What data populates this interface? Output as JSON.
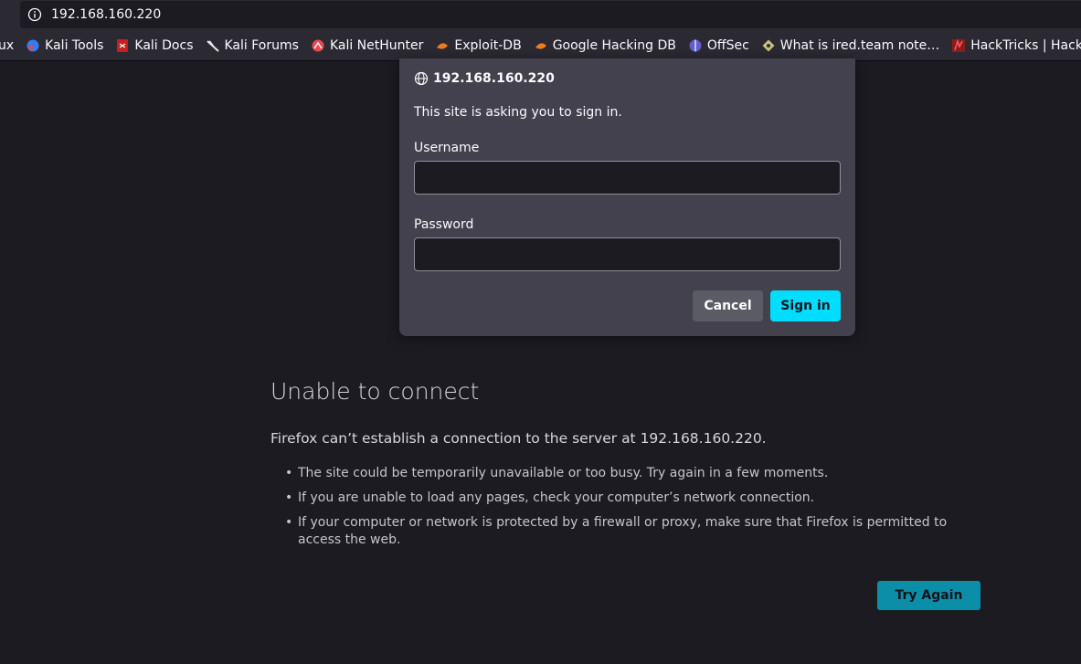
{
  "urlbar": {
    "url": "192.168.160.220",
    "icon": "info-icon"
  },
  "bookmarks": [
    {
      "label": "ux",
      "icon": ""
    },
    {
      "label": "Kali Tools",
      "icon": "kali-tools-icon"
    },
    {
      "label": "Kali Docs",
      "icon": "kali-docs-icon"
    },
    {
      "label": "Kali Forums",
      "icon": "kali-forums-icon"
    },
    {
      "label": "Kali NetHunter",
      "icon": "kali-nethunter-icon"
    },
    {
      "label": "Exploit-DB",
      "icon": "exploit-db-icon"
    },
    {
      "label": "Google Hacking DB",
      "icon": "google-hacking-db-icon"
    },
    {
      "label": "OffSec",
      "icon": "offsec-icon"
    },
    {
      "label": "What is ired.team note…",
      "icon": "ired-team-icon"
    },
    {
      "label": "HackTricks | HackTricks",
      "icon": "hacktricks-icon"
    }
  ],
  "dialog": {
    "host": "192.168.160.220",
    "message": "This site is asking you to sign in.",
    "username_label": "Username",
    "username_value": "",
    "password_label": "Password",
    "password_value": "",
    "cancel_label": "Cancel",
    "signin_label": "Sign in"
  },
  "error": {
    "title": "Unable to connect",
    "description": "Firefox can’t establish a connection to the server at 192.168.160.220.",
    "items": [
      "The site could be temporarily unavailable or too busy. Try again in a few moments.",
      "If you are unable to load any pages, check your computer’s network connection.",
      "If your computer or network is protected by a firewall or proxy, make sure that Firefox is permitted to access the web."
    ],
    "try_again_label": "Try Again"
  },
  "colors": {
    "accent": "#00ddff",
    "try_again": "#0b8fa8",
    "background": "#1c1b22",
    "dialog": "#42414d"
  }
}
